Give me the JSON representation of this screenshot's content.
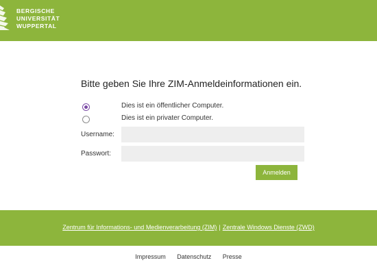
{
  "header": {
    "logo_lines": [
      "BERGISCHE",
      "UNIVERSITÄT",
      "WUPPERTAL"
    ],
    "brand_color": "#8db53c"
  },
  "form": {
    "title": "Bitte geben Sie Ihre ZIM-Anmeldeinformationen ein.",
    "radio_public": "Dies ist ein öffentlicher Computer.",
    "radio_private": "Dies ist ein privater Computer.",
    "selected": "public",
    "username_label": "Username:",
    "username_value": "",
    "password_label": "Passwort:",
    "password_value": "",
    "login_label": "Anmelden"
  },
  "footer": {
    "link_zim": "Zentrum für Informations- und Medienverarbeitung (ZIM)",
    "separator": "|",
    "link_zwd": "Zentrale Windows Dienste (ZWD)",
    "bottom_links": [
      "Impressum",
      "Datenschutz",
      "Presse"
    ]
  }
}
